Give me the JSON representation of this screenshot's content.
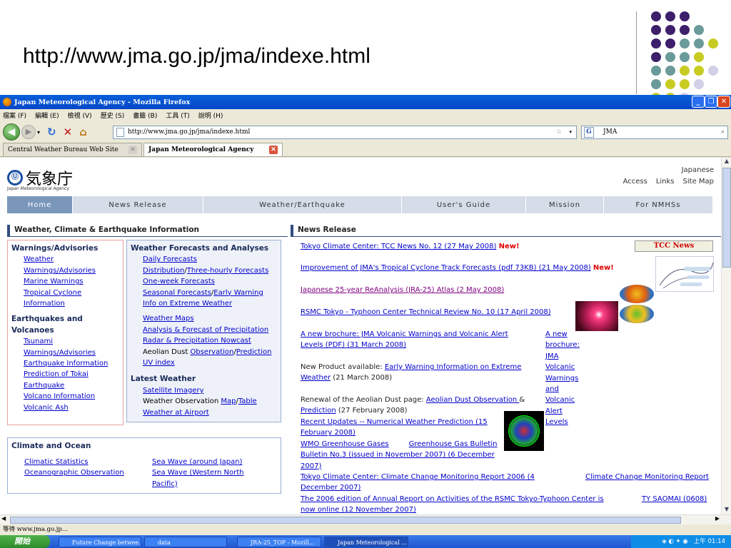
{
  "slide": {
    "title": "http://www.jma.go.jp/jma/indexe.html",
    "dot_colors": {
      "purple": "#3e1f6b",
      "teal": "#6b9a9a",
      "yellow": "#c8cc22",
      "lavender": "#d0d0e8"
    }
  },
  "browser": {
    "window_title": "Japan Meteorological Agency - Mozilla Firefox",
    "menu": [
      "檔案 (F)",
      "編輯 (E)",
      "檢視 (V)",
      "歷史 (S)",
      "書籤 (B)",
      "工具 (T)",
      "說明 (H)"
    ],
    "url": "http://www.jma.go.jp/jma/indexe.html",
    "search_engine": "G",
    "search_value": "JMA",
    "tabs": [
      {
        "label": "Central Weather Bureau Web Site"
      },
      {
        "label": "Japan Meteorological Agency"
      }
    ],
    "status": "等待 www.jma.go.jp..."
  },
  "page": {
    "logo_kanji": "気象庁",
    "logo_sub": "Japan Meteorological Agency",
    "top_links": {
      "japanese": "Japanese",
      "access": "Access",
      "links": "Links",
      "sitemap": "Site Map"
    },
    "nav": [
      "Home",
      "News Release",
      "Weather/Earthquake",
      "User's Guide",
      "Mission",
      "For NMHSs"
    ],
    "left_heading": "Weather, Climate & Earthquake Information",
    "warnings": {
      "title": "Warnings/Advisories",
      "items": [
        "Weather",
        "Warnings/Advisories",
        "Marine Warnings",
        "Tropical Cyclone",
        "Information"
      ]
    },
    "quakes": {
      "title1": "Earthquakes and",
      "title2": "Volcanoes",
      "items": [
        "Tsunami",
        "Warnings/Advisories",
        "Earthquake Information",
        "Prediction of Tokai",
        "Earthquake",
        "Volcano Information",
        "Volcanic Ash"
      ]
    },
    "forecasts": {
      "title": "Weather Forecasts and Analyses",
      "l1": "Daily Forecasts",
      "l2a": "Distribution",
      "l2b": "Three-hourly Forecasts",
      "l3": "One-week Forecasts",
      "l4a": "Seasonal Forecasts",
      "l4b": "Early Warning",
      "l5": "Info on Extreme Weather",
      "l6": "Weather Maps",
      "l7": "Analysis & Forecast of Precipitation",
      "l8": "Radar & Precipitation Nowcast",
      "l9pre": "Aeolian Dust ",
      "l9a": "Observation",
      "l9b": "Prediction",
      "l10": "UV index"
    },
    "latest": {
      "title": "Latest Weather",
      "l1": "Satellite Imagery",
      "l2pre": "Weather Observation ",
      "l2a": "Map",
      "l2b": "Table",
      "l3": "Weather at Airport"
    },
    "climate": {
      "title": "Climate and Ocean",
      "a1": "Climatic Statistics",
      "a2": "Oceanographic Observation",
      "b1": "Sea Wave (around Japan)",
      "b2a": "Sea Wave (Western North",
      "b2b": "Pacific)"
    },
    "news_heading": "News Release",
    "news": {
      "n1": "Tokyo Climate Center: TCC News No. 12 (27 May 2008)",
      "new": "New!",
      "n2": "Improvement of JMA's Tropical Cyclone Track Forecasts (pdf 73KB) (21 May 2008)",
      "n3": "Japanese 25-year ReAnalysis (JRA-25) Atlas (2 May 2008)",
      "n4": "RSMC Tokyo - Typhoon Center Technical Review No. 10 (17 April 2008)",
      "n5a": "A new brochure: JMA Volcanic Warnings and Volcanic Alert",
      "n5b": "Levels (PDF) (31 March 2008)",
      "side1": [
        "A new",
        "brochure:",
        "JMA",
        "Volcanic",
        "Warnings",
        "and",
        "Volcanic",
        "Alert",
        "Levels"
      ],
      "n6pre": "New Product available: ",
      "n6a": "Early Warning Information on Extreme",
      "n6b": "Weather",
      "n6post": " (21 March 2008)",
      "n7pre": "Renewal of the Aeolian Dust page: ",
      "n7a": "Aeolian Dust Observation ",
      "n7amp": "&",
      "n7b": "Prediction",
      "n7post": " (27 February 2008)",
      "n8a": "Recent Updates -- Numerical Weather Prediction (15",
      "n8b": "February 2008)",
      "n9a": "WMO Greenhouse Gases",
      "n9b": "Greenhouse Gas Bulletin",
      "n9c": "Bulletin No.3 (issued in November 2007) (6 December",
      "n9d": "2007)",
      "n10a": "Tokyo Climate Center: Climate Change Monitoring Report 2006 (4",
      "n10b": "December 2007)",
      "n10side": "Climate Change Monitoring Report",
      "n11": "The 2006 edition of Annual Report on Activities of the RSMC Tokyo-Typhoon Center is",
      "n11side": "TY SAOMAI (0608)",
      "n12": "now online (12 November 2007)",
      "tcc_label": "TCC News"
    }
  },
  "taskbar": {
    "start": "開始",
    "tasks": [
      "Future Change betwee...",
      "data",
      "JRA-25_TOP - Mozill...",
      "Japan Meteorological ..."
    ],
    "clock": "上午 01:14"
  }
}
